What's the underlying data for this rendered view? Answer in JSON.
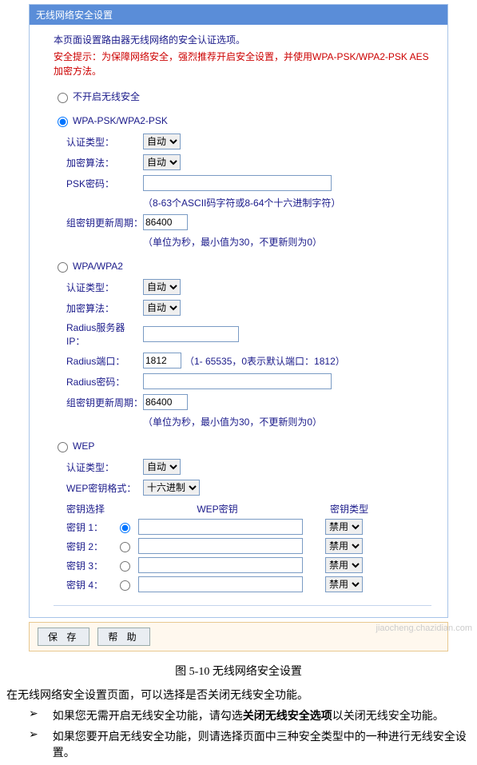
{
  "header": {
    "title": "无线网络安全设置"
  },
  "intro": "本页面设置路由器无线网络的安全认证选项。",
  "warning": "安全提示：为保障网络安全，强烈推荐开启安全设置，并使用WPA-PSK/WPA2-PSK AES加密方法。",
  "nosec": {
    "label": "不开启无线安全"
  },
  "wpapsk": {
    "label": "WPA-PSK/WPA2-PSK",
    "auth_label": "认证类型：",
    "auth_value": "自动",
    "cipher_label": "加密算法：",
    "cipher_value": "自动",
    "psk_label": "PSK密码：",
    "psk_value": "",
    "psk_hint": "（8-63个ASCII码字符或8-64个十六进制字符）",
    "rekey_label": "组密钥更新周期：",
    "rekey_value": "86400",
    "rekey_hint": "（单位为秒，最小值为30，不更新则为0）"
  },
  "wpa": {
    "label": "WPA/WPA2",
    "auth_label": "认证类型：",
    "auth_value": "自动",
    "cipher_label": "加密算法：",
    "cipher_value": "自动",
    "radius_ip_label": "Radius服务器IP：",
    "radius_ip_value": "",
    "radius_port_label": "Radius端口：",
    "radius_port_value": "1812",
    "radius_port_hint": "（1- 65535，0表示默认端口：1812）",
    "radius_pw_label": "Radius密码：",
    "radius_pw_value": "",
    "rekey_label": "组密钥更新周期：",
    "rekey_value": "86400",
    "rekey_hint": "（单位为秒，最小值为30，不更新则为0）"
  },
  "wep": {
    "label": "WEP",
    "auth_label": "认证类型：",
    "auth_value": "自动",
    "fmt_label": "WEP密钥格式：",
    "fmt_value": "十六进制",
    "col_sel": "密钥选择",
    "col_key": "WEP密钥",
    "col_type": "密钥类型",
    "k1": "密钥 1：",
    "k2": "密钥 2：",
    "k3": "密钥 3：",
    "k4": "密钥 4：",
    "disable": "禁用"
  },
  "footer": {
    "save": "保 存",
    "help": "帮 助"
  },
  "caption": "图 5-10  无线网络安全设置",
  "desc": "在无线网络安全设置页面，可以选择是否关闭无线安全功能。",
  "bullet1_a": "如果您无需开启无线安全功能，请勾选",
  "bullet1_b": "关闭无线安全选项",
  "bullet1_c": "以关闭无线安全功能。",
  "bullet2": "如果您要开启无线安全功能，则请选择页面中三种安全类型中的一种进行无线安全设置。",
  "wm": "jiaocheng.chazidian.com"
}
